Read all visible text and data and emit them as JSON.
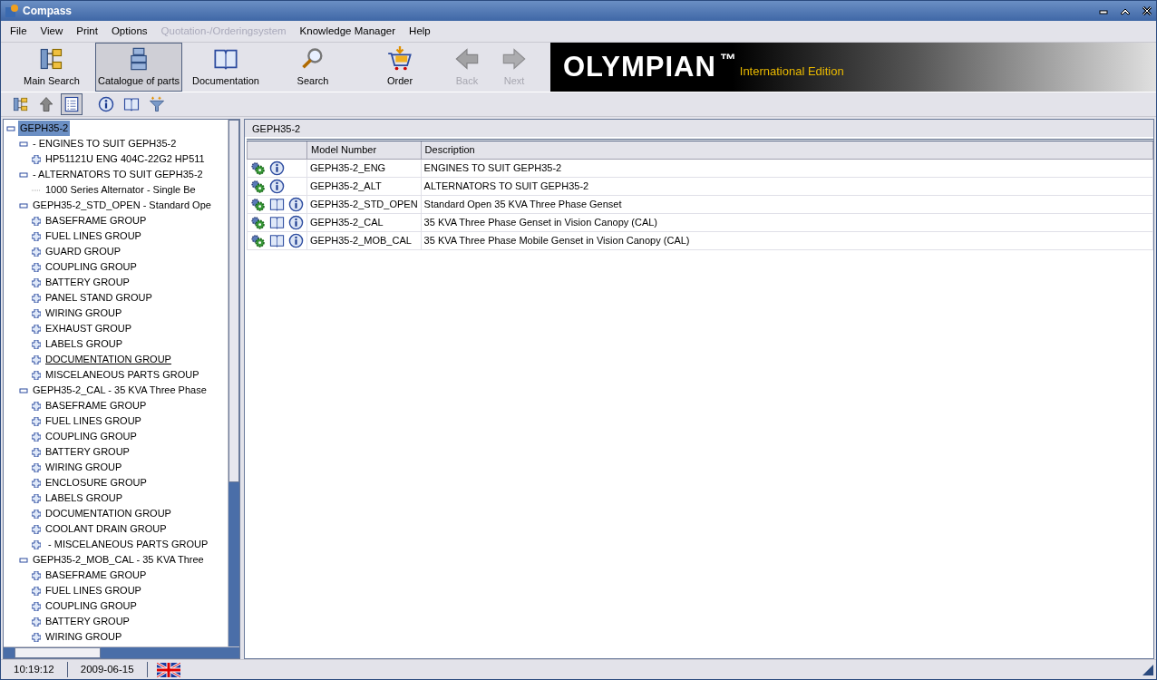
{
  "window": {
    "title": "Compass"
  },
  "menu": [
    {
      "label": "File",
      "disabled": false
    },
    {
      "label": "View",
      "disabled": false
    },
    {
      "label": "Print",
      "disabled": false
    },
    {
      "label": "Options",
      "disabled": false
    },
    {
      "label": "Quotation-/Orderingsystem",
      "disabled": true
    },
    {
      "label": "Knowledge Manager",
      "disabled": false
    },
    {
      "label": "Help",
      "disabled": false
    }
  ],
  "toolbar": [
    {
      "label": "Main Search",
      "kind": "tree",
      "selected": false,
      "disabled": false
    },
    {
      "label": "Catalogue of parts",
      "kind": "parts",
      "selected": true,
      "disabled": false
    },
    {
      "label": "Documentation",
      "kind": "book",
      "selected": false,
      "disabled": false
    },
    {
      "label": "Search",
      "kind": "magnifier",
      "selected": false,
      "disabled": false
    },
    {
      "label": "Order",
      "kind": "cart",
      "selected": false,
      "disabled": false
    },
    {
      "label": "Back",
      "kind": "left",
      "selected": false,
      "disabled": true
    },
    {
      "label": "Next",
      "kind": "right",
      "selected": false,
      "disabled": true
    }
  ],
  "brand": {
    "name": "OLYMPIAN",
    "trademark": "™",
    "edition": "International Edition"
  },
  "subtoolbar": [
    {
      "kind": "tree",
      "selected": false
    },
    {
      "kind": "up",
      "selected": false
    },
    {
      "kind": "list",
      "selected": true
    },
    {
      "kind": "info",
      "selected": false
    },
    {
      "kind": "book",
      "selected": false
    },
    {
      "kind": "funnel",
      "selected": false
    }
  ],
  "tree": [
    {
      "label": "GEPH35-2",
      "expanded": true,
      "selected": true,
      "children": [
        {
          "label": "- ENGINES TO SUIT GEPH35-2",
          "expanded": true,
          "children": [
            {
              "label": "HP51121U ENG 404C-22G2 HP511",
              "expanded": false
            }
          ]
        },
        {
          "label": "- ALTERNATORS TO SUIT GEPH35-2",
          "expanded": true,
          "children": [
            {
              "label": "1000 Series Alternator - Single Be"
            }
          ]
        },
        {
          "label": "GEPH35-2_STD_OPEN - Standard Ope",
          "expanded": true,
          "children": [
            {
              "label": "BASEFRAME GROUP",
              "expanded": false
            },
            {
              "label": "FUEL LINES GROUP",
              "expanded": false
            },
            {
              "label": "GUARD GROUP",
              "expanded": false
            },
            {
              "label": "COUPLING GROUP",
              "expanded": false
            },
            {
              "label": "BATTERY GROUP",
              "expanded": false
            },
            {
              "label": "PANEL STAND GROUP",
              "expanded": false
            },
            {
              "label": "WIRING GROUP",
              "expanded": false
            },
            {
              "label": "EXHAUST GROUP",
              "expanded": false
            },
            {
              "label": "LABELS GROUP",
              "expanded": false
            },
            {
              "label": "DOCUMENTATION GROUP",
              "expanded": false,
              "hovered": true
            },
            {
              "label": "MISCELANEOUS PARTS GROUP",
              "expanded": false
            }
          ]
        },
        {
          "label": "GEPH35-2_CAL - 35 KVA Three Phase",
          "expanded": true,
          "children": [
            {
              "label": "BASEFRAME GROUP",
              "expanded": false
            },
            {
              "label": "FUEL LINES GROUP",
              "expanded": false
            },
            {
              "label": "COUPLING GROUP",
              "expanded": false
            },
            {
              "label": "BATTERY GROUP",
              "expanded": false
            },
            {
              "label": "WIRING GROUP",
              "expanded": false
            },
            {
              "label": "ENCLOSURE GROUP",
              "expanded": false
            },
            {
              "label": "LABELS GROUP",
              "expanded": false
            },
            {
              "label": "DOCUMENTATION GROUP",
              "expanded": false
            },
            {
              "label": "COOLANT DRAIN GROUP",
              "expanded": false
            },
            {
              "label": " - MISCELANEOUS PARTS GROUP",
              "expanded": false
            }
          ]
        },
        {
          "label": "GEPH35-2_MOB_CAL - 35 KVA Three",
          "expanded": true,
          "children": [
            {
              "label": "BASEFRAME GROUP",
              "expanded": false
            },
            {
              "label": "FUEL LINES GROUP",
              "expanded": false
            },
            {
              "label": "COUPLING GROUP",
              "expanded": false
            },
            {
              "label": "BATTERY GROUP",
              "expanded": false
            },
            {
              "label": "WIRING GROUP",
              "expanded": false
            }
          ]
        }
      ]
    }
  ],
  "panel": {
    "title": "GEPH35-2",
    "table": {
      "columns": [
        "Model Number",
        "Description"
      ],
      "rows": [
        {
          "has_documentation": false,
          "model_number": "GEPH35-2_ENG",
          "description": "ENGINES TO SUIT GEPH35-2"
        },
        {
          "has_documentation": false,
          "model_number": "GEPH35-2_ALT",
          "description": "ALTERNATORS TO SUIT GEPH35-2"
        },
        {
          "has_documentation": true,
          "model_number": "GEPH35-2_STD_OPEN",
          "description": "Standard Open 35 KVA Three Phase Genset"
        },
        {
          "has_documentation": true,
          "model_number": "GEPH35-2_CAL",
          "description": "35 KVA Three Phase Genset in Vision Canopy (CAL)"
        },
        {
          "has_documentation": true,
          "model_number": "GEPH35-2_MOB_CAL",
          "description": "35 KVA Three Phase Mobile Genset in Vision Canopy (CAL)"
        }
      ]
    }
  },
  "status_bar": {
    "time": "10:19:12",
    "date": "2009-06-15"
  }
}
